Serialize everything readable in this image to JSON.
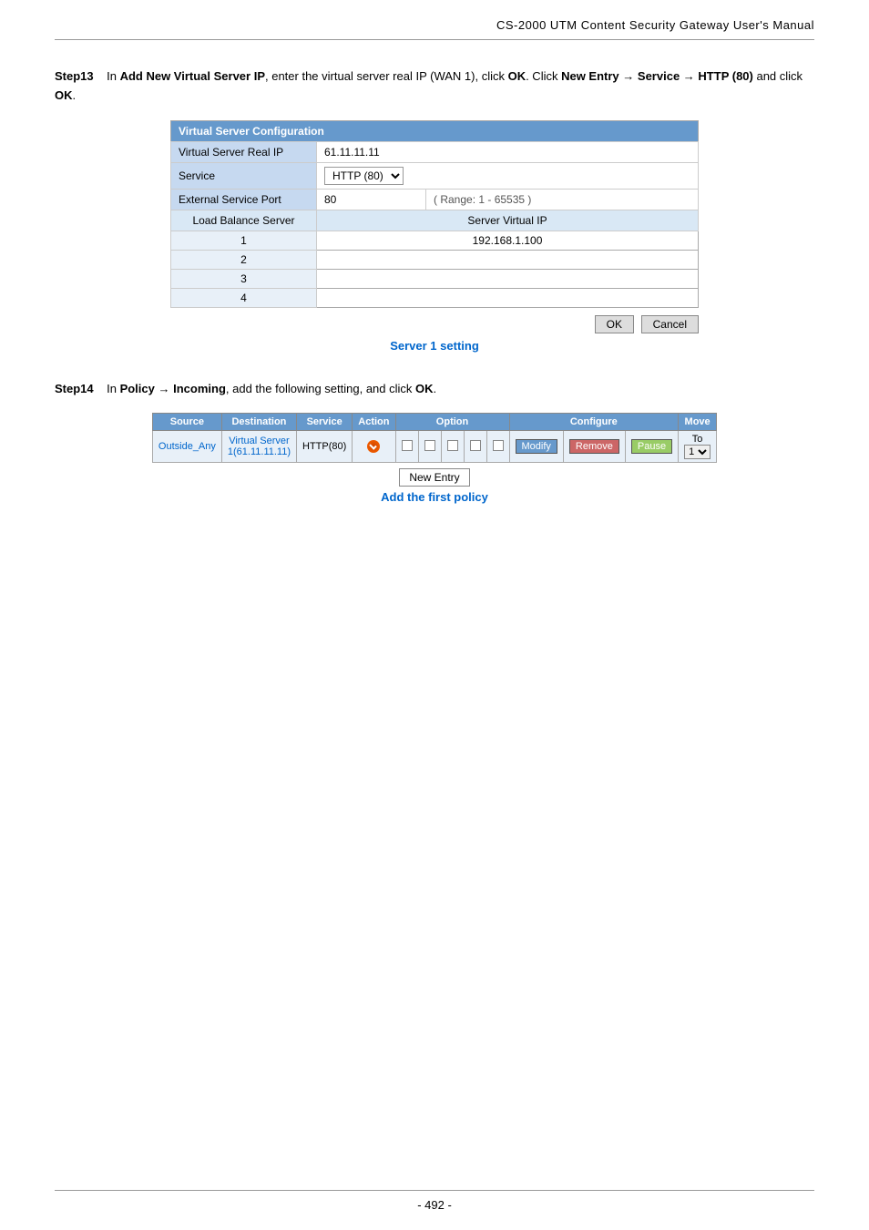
{
  "header": {
    "title": "CS-2000  UTM  Content  Security  Gateway  User's  Manual"
  },
  "footer": {
    "page": "- 492 -"
  },
  "step13": {
    "label": "Step13",
    "text1": "In ",
    "bold1": "Add New Virtual Server IP",
    "text2": ", enter the virtual server real IP (WAN 1), click ",
    "bold2": "OK",
    "text3": ". Click ",
    "bold3": "New Entry",
    "arrow1": "→",
    "bold4": "Service",
    "arrow2": "→",
    "bold5": "HTTP (80)",
    "text4": " and click ",
    "bold6": "OK",
    "text5": ".",
    "vsc": {
      "title": "Virtual Server Configuration",
      "fields": [
        {
          "label": "Virtual Server Real IP",
          "value": "61.11.11.11"
        },
        {
          "label": "Service",
          "value": "HTTP (80)",
          "type": "select"
        },
        {
          "label": "External Service Port",
          "value": "80",
          "hint": "( Range: 1 - 65535 )"
        }
      ],
      "subheaders": [
        "Load Balance Server",
        "Server Virtual IP"
      ],
      "rows": [
        {
          "num": "1",
          "ip": "192.168.1.100"
        },
        {
          "num": "2",
          "ip": ""
        },
        {
          "num": "3",
          "ip": ""
        },
        {
          "num": "4",
          "ip": ""
        }
      ],
      "ok_btn": "OK",
      "cancel_btn": "Cancel"
    },
    "caption": "Server 1 setting"
  },
  "step14": {
    "label": "Step14",
    "text1": "In ",
    "bold1": "Policy",
    "arrow1": "→",
    "bold2": "Incoming",
    "text2": ", add the following setting, and click ",
    "bold3": "OK",
    "text3": ".",
    "policy_table": {
      "headers": [
        "Source",
        "Destination",
        "Service",
        "Action",
        "Option",
        "Configure",
        "Move"
      ],
      "row": {
        "source": "Outside_Any",
        "destination": "Virtual Server 1(61.11.11.11)",
        "service": "HTTP(80)",
        "action_icon": "fire-icon",
        "options": [
          "",
          "",
          "",
          "",
          ""
        ],
        "modify": "Modify",
        "remove": "Remove",
        "pause": "Pause",
        "move_label": "To",
        "move_value": "1"
      }
    },
    "new_entry_btn": "New Entry",
    "add_first_policy": "Add the first policy"
  }
}
